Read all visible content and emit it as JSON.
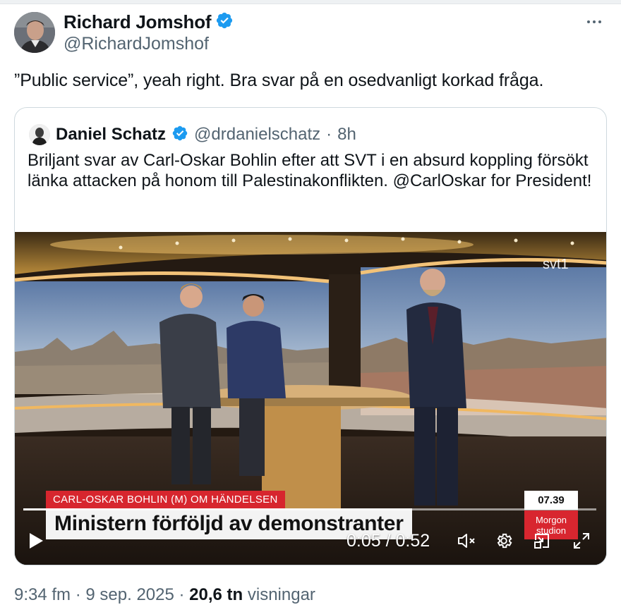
{
  "tweet": {
    "author_name": "Richard Jomshof",
    "author_handle": "@RichardJomshof",
    "text": "”Public service”, yeah right. Bra svar på en osedvanligt korkad fråga.",
    "time": "9:34 fm",
    "date": "9 sep. 2025",
    "views_count": "20,6 tn",
    "views_label": "visningar",
    "sep": "·"
  },
  "quote": {
    "author_name": "Daniel Schatz",
    "author_handle": "@drdanielschatz",
    "age": "8h",
    "text": "Briljant svar av Carl-Oskar Bohlin efter att SVT i en absurd koppling försökt länka attacken på honom till Palestinakonflikten. @CarlOskar for President!"
  },
  "video": {
    "channel_logo": "svt1",
    "lower_third_label": "CARL-OSKAR BOHLIN (M) OM HÄNDELSEN",
    "lower_third_title": "Ministern förföljd av demonstranter",
    "clock": "07.39",
    "show_name_line1": "Morgon",
    "show_name_line2": "studion",
    "time_readout": "0:05 / 0:52",
    "progress": 0.09
  },
  "icons": {
    "verified": "verified-badge-icon",
    "more": "more-options-icon",
    "play": "play-icon",
    "mute": "mute-icon",
    "settings": "gear-icon",
    "pip": "picture-in-picture-icon",
    "fullscreen": "fullscreen-icon"
  },
  "colors": {
    "verified_blue": "#1d9bf0",
    "secondary_text": "#536471",
    "svt_red": "#d7262e"
  }
}
